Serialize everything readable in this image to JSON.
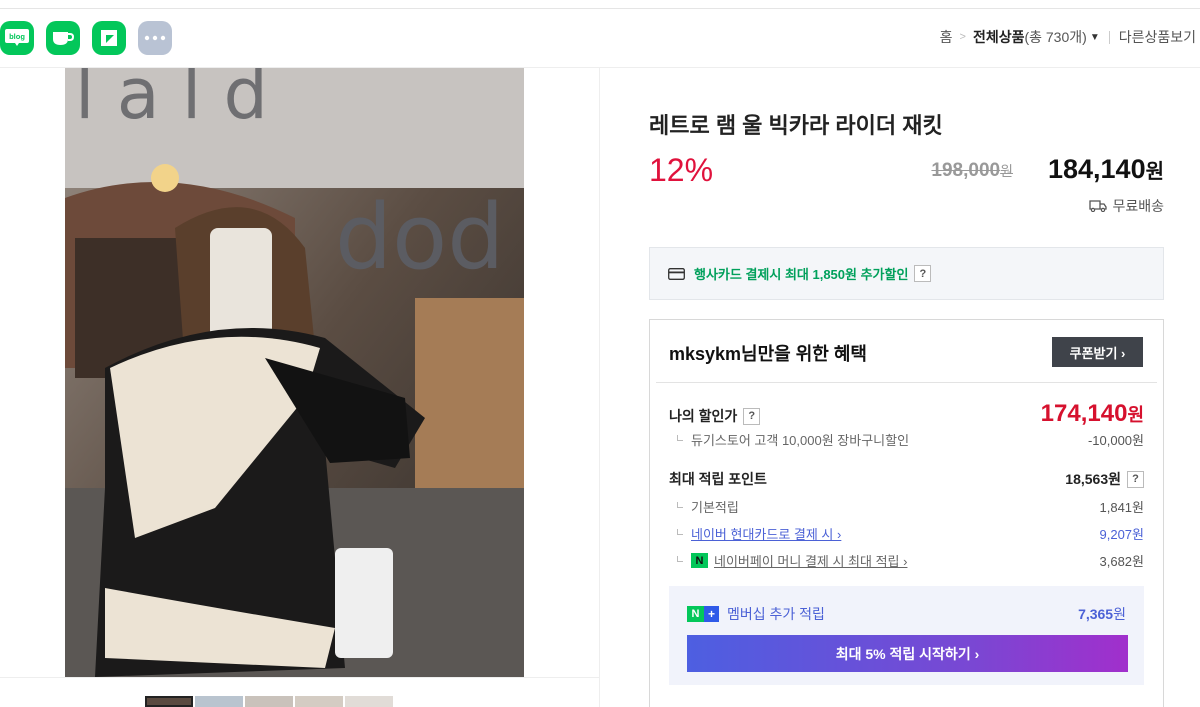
{
  "share": {
    "blog_text": "blog",
    "items": [
      "blog-share",
      "cafe-share",
      "kakao-share",
      "more"
    ],
    "colors": {
      "naver_green": "#03c75a",
      "more_gray": "#b9c3d4"
    }
  },
  "breadcrumb": {
    "home": "홈",
    "category": "전체상품",
    "count": "(총 730개)",
    "other": "다른상품보기"
  },
  "product": {
    "title": "레트로 램 울 빅카라 라이더 재킷",
    "discount_rate": "12%",
    "original_price": "198,000",
    "original_unit": "원",
    "price": "184,140",
    "price_unit": "원",
    "shipping": "무료배송",
    "card_benefit": "행사카드 결제시 최대 1,850원 추가할인",
    "help_mark": "?"
  },
  "benefit": {
    "heading": "mksykm님만을 위한 혜택",
    "coupon_button": "쿠폰받기 ›",
    "my_price_label": "나의 할인가",
    "my_price": "174,140",
    "my_price_unit": "원",
    "store_discount_label": "듀기스토어 고객 10,000원 장바구니할인",
    "store_discount_value": "-10,000원",
    "points_label": "최대 적립 포인트",
    "points_value": "18,563원",
    "basic_label": "기본적립",
    "basic_value": "1,841원",
    "hyundai_label": "네이버 현대카드로 결제 시 ›",
    "hyundai_value": "9,207원",
    "npay_label": "네이버페이 머니 결제 시 최대 적립 ›",
    "npay_value": "3,682원",
    "npay_icon_text": "N",
    "membership_label": "멤버십 추가 적립",
    "membership_value": "7,365",
    "membership_unit": "원",
    "membership_badge_n": "N",
    "membership_badge_plus": "+",
    "start_button": "최대 5% 적립 시작하기 ›"
  },
  "colors": {
    "accent_red": "#e0123c",
    "green": "#00a05b",
    "blue": "#4b61d6",
    "gradient_start": "#4d5fe1",
    "gradient_end": "#a12fcc"
  }
}
